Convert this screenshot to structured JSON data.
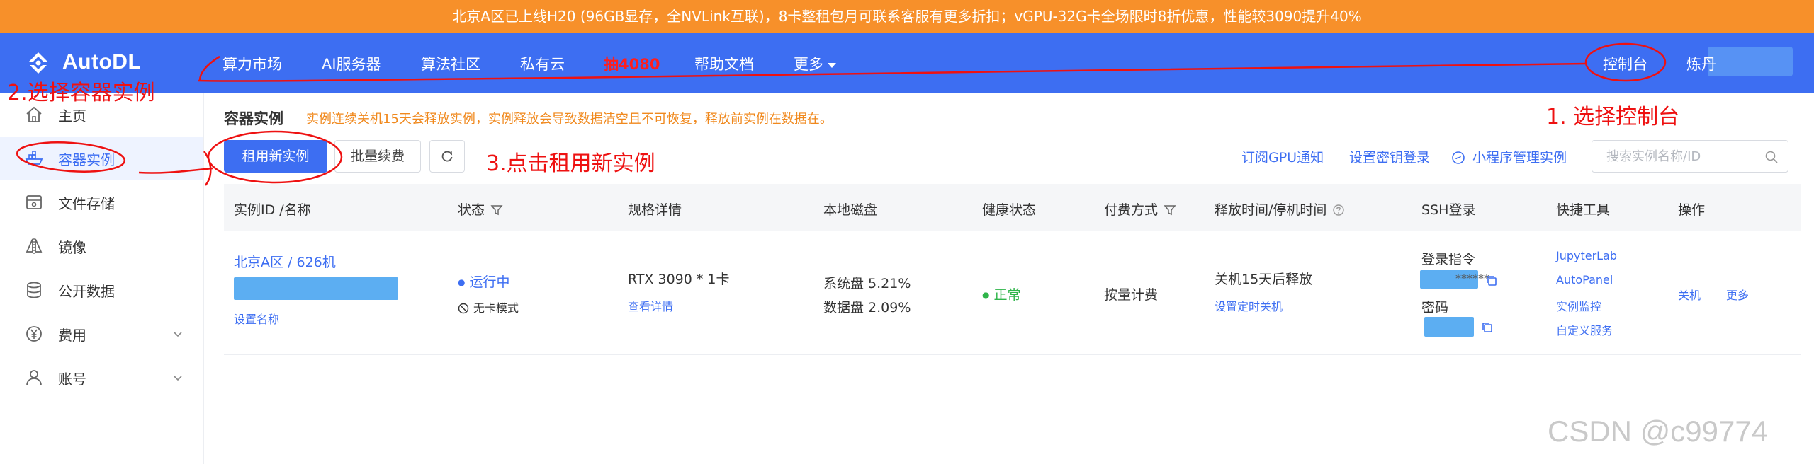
{
  "banner": {
    "text": "北京A区已上线H20 (96GB显存，全NVLink互联)，8卡整租包月可联系客服有更多折扣；vGPU-32G卡全场限时8折优惠，性能较3090提升40%"
  },
  "navbar": {
    "logo": "AutoDL",
    "items": [
      "算力市场",
      "AI服务器",
      "算法社区",
      "私有云",
      "抽4080",
      "帮助文档",
      "更多"
    ],
    "console": "控制台",
    "user": "炼丹"
  },
  "sidebar": {
    "items": [
      {
        "label": "主页",
        "icon": "home-icon"
      },
      {
        "label": "容器实例",
        "icon": "container-icon"
      },
      {
        "label": "文件存储",
        "icon": "storage-icon"
      },
      {
        "label": "镜像",
        "icon": "image-icon"
      },
      {
        "label": "公开数据",
        "icon": "database-icon"
      },
      {
        "label": "费用",
        "icon": "yen-icon"
      },
      {
        "label": "账号",
        "icon": "user-icon"
      }
    ]
  },
  "page": {
    "title": "容器实例",
    "notice": "实例连续关机15天会释放实例，实例释放会导致数据清空且不可恢复，释放前实例在数据在。",
    "rent_button": "租用新实例",
    "renew_button": "批量续费",
    "links": {
      "gpu_notice": "订阅GPU通知",
      "ssh_key": "设置密钥登录",
      "mini_program": "小程序管理实例"
    },
    "search_placeholder": "搜索实例名称/ID"
  },
  "table": {
    "headers": [
      "实例ID /名称",
      "状态",
      "规格详情",
      "本地磁盘",
      "健康状态",
      "付费方式",
      "释放时间/停机时间",
      "SSH登录",
      "快捷工具",
      "操作"
    ],
    "row": {
      "name": "北京A区 / 626机",
      "set_name": "设置名称",
      "status": "运行中",
      "mode": "无卡模式",
      "spec": "RTX 3090 * 1卡",
      "spec_link": "查看详情",
      "disk_sys": "系统盘 5.21%",
      "disk_data": "数据盘 2.09%",
      "health": "正常",
      "billing": "按量计费",
      "release": "关机15天后释放",
      "release_link": "设置定时关机",
      "ssh_cmd_label": "登录指令",
      "ssh_cmd_mask": "******",
      "ssh_pwd_label": "密码",
      "tools": [
        "JupyterLab",
        "AutoPanel",
        "实例监控",
        "自定义服务"
      ],
      "actions": [
        "关机",
        "更多"
      ]
    }
  },
  "annotations": {
    "step1": "1. 选择控制台",
    "step2": "2.选择容器实例",
    "step3": "3.点击租用新实例"
  },
  "watermark": "CSDN @c99774",
  "colors": {
    "banner": "#f7902a",
    "navbar": "#3d6ef2",
    "primary": "#3d6ef2",
    "notice": "#f0891e",
    "ok": "#2fb54a",
    "annotation": "#ee1111"
  }
}
